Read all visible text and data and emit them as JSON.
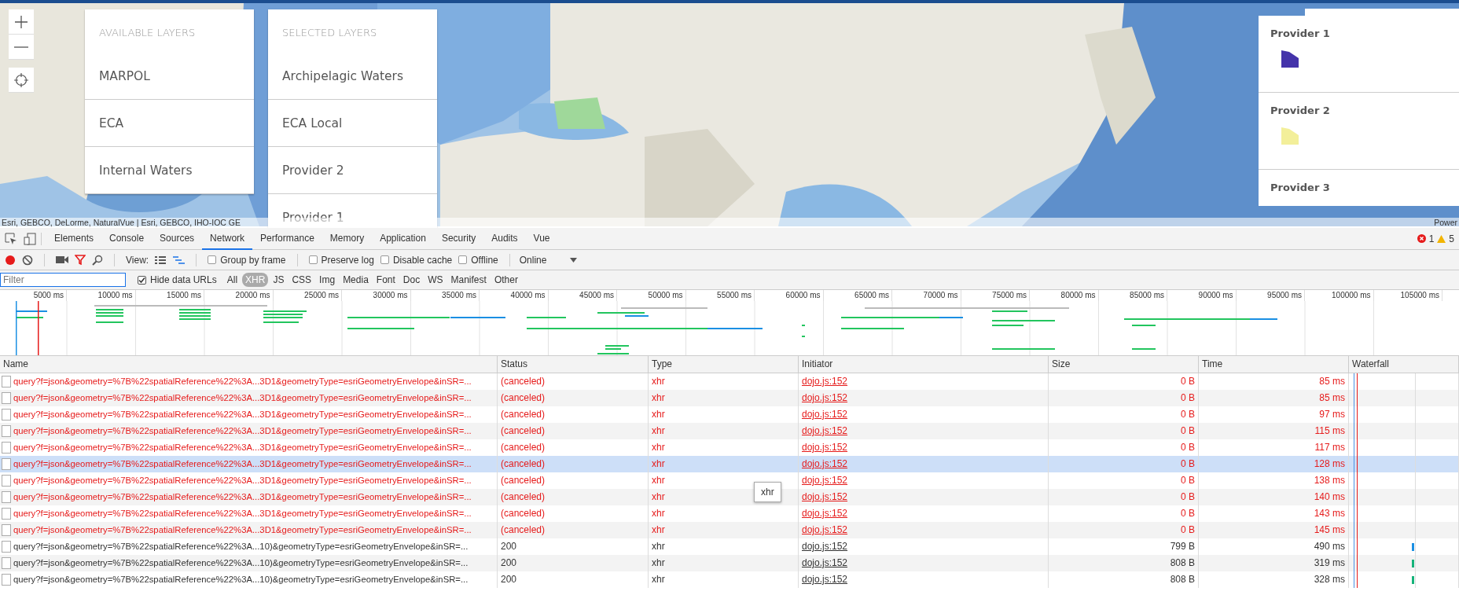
{
  "map": {
    "available_layers": {
      "title": "AVAILABLE LAYERS",
      "items": [
        "MARPOL",
        "ECA",
        "Internal Waters"
      ]
    },
    "selected_layers": {
      "title": "SELECTED LAYERS",
      "items": [
        "Archipelagic Waters",
        "ECA Local",
        "Provider 2",
        "Provider 1"
      ]
    },
    "legend": [
      {
        "label": "Provider 1",
        "color": "#4433aa"
      },
      {
        "label": "Provider 2",
        "color": "#f3ef9a"
      },
      {
        "label": "Provider 3"
      }
    ],
    "attribution": "Esri, GEBCO, DeLorme, NaturalVue | Esri, GEBCO, IHO-IOC GE",
    "powered": "Power"
  },
  "devtools": {
    "tabs": [
      {
        "label": "Elements",
        "selected": false
      },
      {
        "label": "Console",
        "selected": false
      },
      {
        "label": "Sources",
        "selected": false
      },
      {
        "label": "Network",
        "selected": true
      },
      {
        "label": "Performance",
        "selected": false
      },
      {
        "label": "Memory",
        "selected": false
      },
      {
        "label": "Application",
        "selected": false
      },
      {
        "label": "Security",
        "selected": false
      },
      {
        "label": "Audits",
        "selected": false
      },
      {
        "label": "Vue",
        "selected": false
      }
    ],
    "error_count": "1",
    "warning_count": "5",
    "toolbar": {
      "recording": true,
      "filter_active": true,
      "view_label": "View:",
      "views": [
        {
          "kind": "list",
          "selected": false
        },
        {
          "kind": "waterfall",
          "selected": true
        }
      ],
      "checkboxes": [
        {
          "label": "Group by frame",
          "checked": false
        },
        {
          "label": "Preserve log",
          "checked": false
        },
        {
          "label": "Disable cache",
          "checked": false
        },
        {
          "label": "Offline",
          "checked": false
        }
      ],
      "throttle": "Online"
    },
    "filter": {
      "placeholder": "Filter",
      "hide_data_urls": {
        "label": "Hide data URLs",
        "checked": true
      },
      "types": [
        {
          "label": "All",
          "selected": false
        },
        {
          "label": "XHR",
          "selected": true
        },
        {
          "label": "JS",
          "selected": false
        },
        {
          "label": "CSS",
          "selected": false
        },
        {
          "label": "Img",
          "selected": false
        },
        {
          "label": "Media",
          "selected": false
        },
        {
          "label": "Font",
          "selected": false
        },
        {
          "label": "Doc",
          "selected": false
        },
        {
          "label": "WS",
          "selected": false
        },
        {
          "label": "Manifest",
          "selected": false
        },
        {
          "label": "Other",
          "selected": false
        }
      ]
    },
    "overview": {
      "ticks": [
        "5000 ms",
        "10000 ms",
        "15000 ms",
        "20000 ms",
        "25000 ms",
        "30000 ms",
        "35000 ms",
        "40000 ms",
        "45000 ms",
        "50000 ms",
        "55000 ms",
        "60000 ms",
        "65000 ms",
        "70000 ms",
        "75000 ms",
        "80000 ms",
        "85000 ms",
        "90000 ms",
        "95000 ms",
        "100000 ms",
        "105000 ms"
      ]
    },
    "table": {
      "columns": [
        "Name",
        "Status",
        "Type",
        "Initiator",
        "Size",
        "Time",
        "Waterfall"
      ],
      "rows": [
        {
          "name": "query?f=json&geometry=%7B%22spatialReference%22%3A...3D1&geometryType=esriGeometryEnvelope&inSR=...",
          "status": "(canceled)",
          "type": "xhr",
          "initiator": "dojo.js:152",
          "size": "0 B",
          "time": "85 ms",
          "failed": true,
          "hovered": false
        },
        {
          "name": "query?f=json&geometry=%7B%22spatialReference%22%3A...3D1&geometryType=esriGeometryEnvelope&inSR=...",
          "status": "(canceled)",
          "type": "xhr",
          "initiator": "dojo.js:152",
          "size": "0 B",
          "time": "85 ms",
          "failed": true,
          "hovered": false
        },
        {
          "name": "query?f=json&geometry=%7B%22spatialReference%22%3A...3D1&geometryType=esriGeometryEnvelope&inSR=...",
          "status": "(canceled)",
          "type": "xhr",
          "initiator": "dojo.js:152",
          "size": "0 B",
          "time": "97 ms",
          "failed": true,
          "hovered": false
        },
        {
          "name": "query?f=json&geometry=%7B%22spatialReference%22%3A...3D1&geometryType=esriGeometryEnvelope&inSR=...",
          "status": "(canceled)",
          "type": "xhr",
          "initiator": "dojo.js:152",
          "size": "0 B",
          "time": "115 ms",
          "failed": true,
          "hovered": false
        },
        {
          "name": "query?f=json&geometry=%7B%22spatialReference%22%3A...3D1&geometryType=esriGeometryEnvelope&inSR=...",
          "status": "(canceled)",
          "type": "xhr",
          "initiator": "dojo.js:152",
          "size": "0 B",
          "time": "117 ms",
          "failed": true,
          "hovered": false
        },
        {
          "name": "query?f=json&geometry=%7B%22spatialReference%22%3A...3D1&geometryType=esriGeometryEnvelope&inSR=...",
          "status": "(canceled)",
          "type": "xhr",
          "initiator": "dojo.js:152",
          "size": "0 B",
          "time": "128 ms",
          "failed": true,
          "hovered": true
        },
        {
          "name": "query?f=json&geometry=%7B%22spatialReference%22%3A...3D1&geometryType=esriGeometryEnvelope&inSR=...",
          "status": "(canceled)",
          "type": "xhr",
          "initiator": "dojo.js:152",
          "size": "0 B",
          "time": "138 ms",
          "failed": true,
          "hovered": false
        },
        {
          "name": "query?f=json&geometry=%7B%22spatialReference%22%3A...3D1&geometryType=esriGeometryEnvelope&inSR=...",
          "status": "(canceled)",
          "type": "xhr",
          "initiator": "dojo.js:152",
          "size": "0 B",
          "time": "140 ms",
          "failed": true,
          "hovered": false
        },
        {
          "name": "query?f=json&geometry=%7B%22spatialReference%22%3A...3D1&geometryType=esriGeometryEnvelope&inSR=...",
          "status": "(canceled)",
          "type": "xhr",
          "initiator": "dojo.js:152",
          "size": "0 B",
          "time": "143 ms",
          "failed": true,
          "hovered": false
        },
        {
          "name": "query?f=json&geometry=%7B%22spatialReference%22%3A...3D1&geometryType=esriGeometryEnvelope&inSR=...",
          "status": "(canceled)",
          "type": "xhr",
          "initiator": "dojo.js:152",
          "size": "0 B",
          "time": "145 ms",
          "failed": true,
          "hovered": false
        },
        {
          "name": "query?f=json&geometry=%7B%22spatialReference%22%3A...10)&geometryType=esriGeometryEnvelope&inSR=...",
          "status": "200",
          "type": "xhr",
          "initiator": "dojo.js:152",
          "size": "799 B",
          "time": "490 ms",
          "failed": false,
          "hovered": false,
          "color": "#1a8fe3"
        },
        {
          "name": "query?f=json&geometry=%7B%22spatialReference%22%3A...10)&geometryType=esriGeometryEnvelope&inSR=...",
          "status": "200",
          "type": "xhr",
          "initiator": "dojo.js:152",
          "size": "808 B",
          "time": "319 ms",
          "failed": false,
          "hovered": false,
          "color": "#15b37a"
        },
        {
          "name": "query?f=json&geometry=%7B%22spatialReference%22%3A...10)&geometryType=esriGeometryEnvelope&inSR=...",
          "status": "200",
          "type": "xhr",
          "initiator": "dojo.js:152",
          "size": "808 B",
          "time": "328 ms",
          "failed": false,
          "hovered": false,
          "color": "#15b37a"
        }
      ]
    },
    "tooltip": "xhr"
  }
}
